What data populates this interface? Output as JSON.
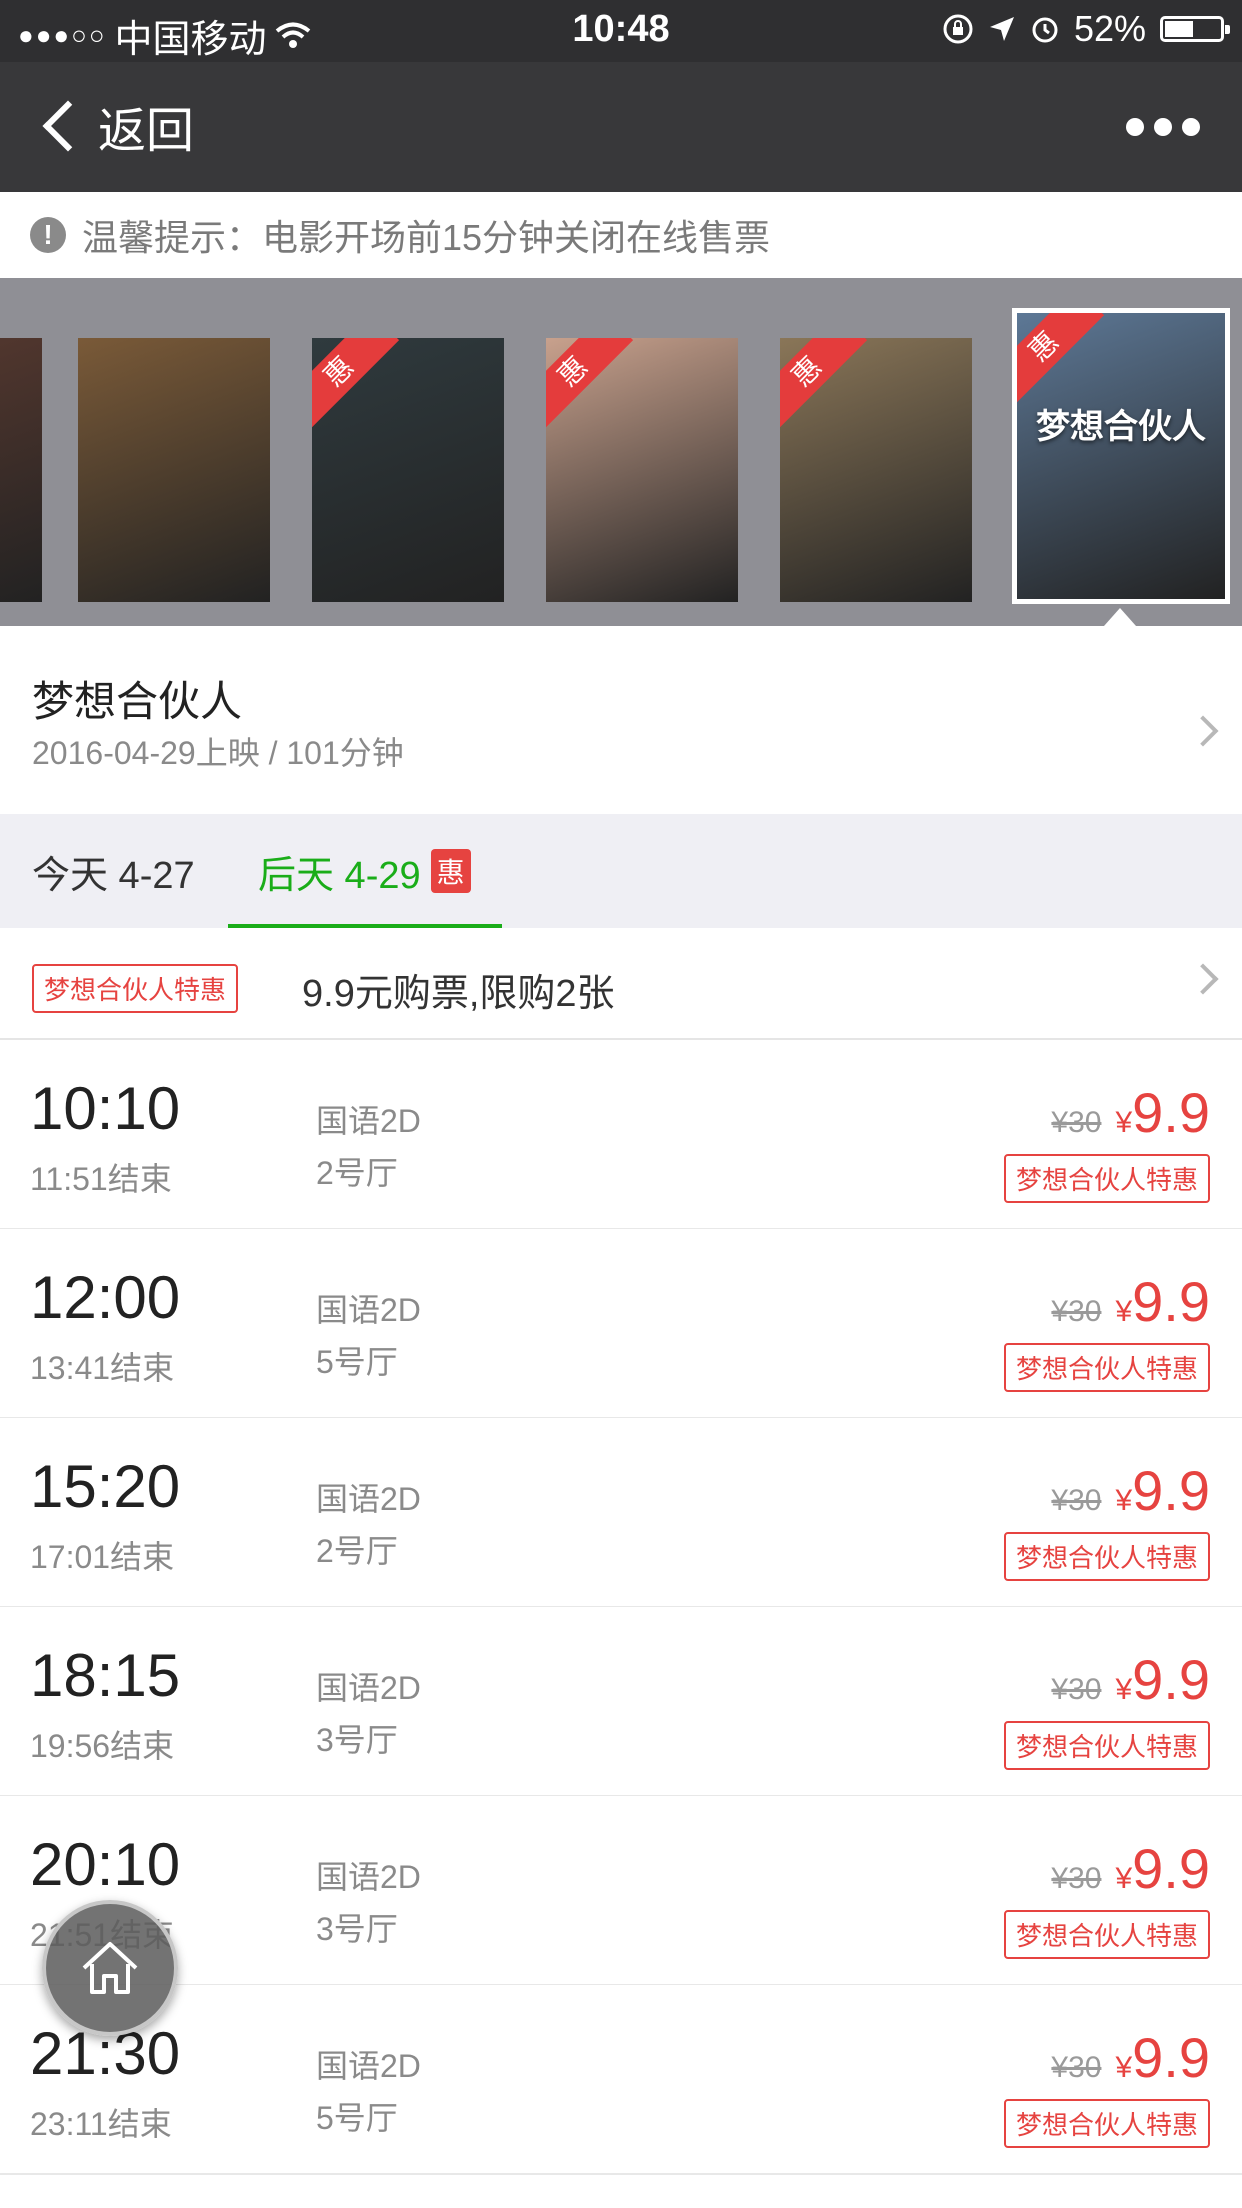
{
  "status": {
    "carrier": "中国移动",
    "time": "10:48",
    "battery": "52%",
    "battery_level": 0.52
  },
  "nav": {
    "back_label": "返回"
  },
  "notice": {
    "icon": "!",
    "text": "温馨提示：电影开场前15分钟关闭在线售票"
  },
  "posters": [
    {
      "title": "",
      "badge": "",
      "color": "#5a3a30"
    },
    {
      "title": "",
      "badge": "",
      "color": "#7a5a38"
    },
    {
      "title": "",
      "badge": "惠",
      "color": "#2f3a3e"
    },
    {
      "title": "",
      "badge": "惠",
      "color": "#c8a18d"
    },
    {
      "title": "",
      "badge": "惠",
      "color": "#8a7658"
    },
    {
      "title": "梦想合伙人",
      "badge": "惠",
      "color": "#5d7896",
      "selected": true
    }
  ],
  "movie": {
    "title": "梦想合伙人",
    "meta": "2016-04-29上映 / 101分钟"
  },
  "tabs": [
    {
      "label": "今天 4-27",
      "active": false
    },
    {
      "label": "后天 4-29",
      "active": true,
      "badge": "惠"
    }
  ],
  "promo": {
    "tag": "梦想合伙人特惠",
    "text": "9.9元购票,限购2张"
  },
  "showtimes": [
    {
      "start": "10:10",
      "end": "11:51结束",
      "lang": "国语2D",
      "hall": "2号厅",
      "orig_price": "¥30",
      "currency": "¥",
      "price": "9.9",
      "tag": "梦想合伙人特惠"
    },
    {
      "start": "12:00",
      "end": "13:41结束",
      "lang": "国语2D",
      "hall": "5号厅",
      "orig_price": "¥30",
      "currency": "¥",
      "price": "9.9",
      "tag": "梦想合伙人特惠"
    },
    {
      "start": "15:20",
      "end": "17:01结束",
      "lang": "国语2D",
      "hall": "2号厅",
      "orig_price": "¥30",
      "currency": "¥",
      "price": "9.9",
      "tag": "梦想合伙人特惠"
    },
    {
      "start": "18:15",
      "end": "19:56结束",
      "lang": "国语2D",
      "hall": "3号厅",
      "orig_price": "¥30",
      "currency": "¥",
      "price": "9.9",
      "tag": "梦想合伙人特惠"
    },
    {
      "start": "20:10",
      "end": "21:51结束",
      "lang": "国语2D",
      "hall": "3号厅",
      "orig_price": "¥30",
      "currency": "¥",
      "price": "9.9",
      "tag": "梦想合伙人特惠"
    },
    {
      "start": "21:30",
      "end": "23:11结束",
      "lang": "国语2D",
      "hall": "5号厅",
      "orig_price": "¥30",
      "currency": "¥",
      "price": "9.9",
      "tag": "梦想合伙人特惠"
    }
  ],
  "colors": {
    "accent_green": "#1aad19",
    "price_red": "#e64340",
    "nav_bg": "#38383a"
  }
}
